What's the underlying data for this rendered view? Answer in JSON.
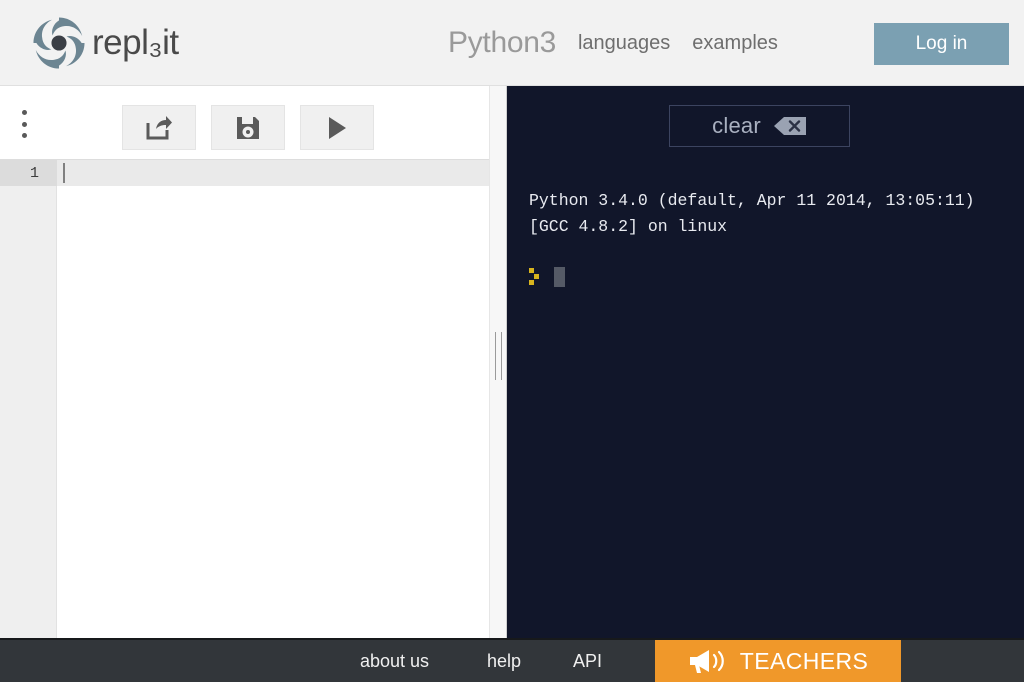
{
  "header": {
    "logo_icon": "replit-spiral-logo-icon",
    "brand": "repl₃it",
    "language": "Python3",
    "nav_links": [
      {
        "label": "languages",
        "name": "languages"
      },
      {
        "label": "examples",
        "name": "examples"
      }
    ],
    "login_label": "Log in",
    "login_color": "#7ba0b2",
    "background_color": "#f2f2f2"
  },
  "toolbar": {
    "menu_icon": "three-dots-vertical-icon",
    "buttons": [
      {
        "icon": "share-export-icon",
        "name": "share"
      },
      {
        "icon": "floppy-disk-save-icon",
        "name": "save"
      },
      {
        "icon": "play-run-icon",
        "name": "run"
      }
    ]
  },
  "editor": {
    "line_numbers": [
      "1"
    ],
    "code_lines": [
      ""
    ],
    "active_line": 1
  },
  "console": {
    "clear_label": "clear",
    "clear_icon": "backspace-delete-icon",
    "output": "Python 3.4.0 (default, Apr 11 2014, 13:05:11)\n[GCC 4.8.2] on linux",
    "prompt_icon": "yellow-chevron-prompt-icon",
    "prompt_color": "#d8b41e",
    "background_color": "#11162a",
    "text_color": "#e8eaf0"
  },
  "footer": {
    "links": [
      {
        "label": "about us",
        "name": "about-us"
      },
      {
        "label": "help",
        "name": "help"
      },
      {
        "label": "API",
        "name": "api"
      }
    ],
    "teachers_label": "TEACHERS",
    "teachers_icon": "megaphone-icon",
    "teachers_color": "#f0982a",
    "background_color": "#32363a"
  }
}
